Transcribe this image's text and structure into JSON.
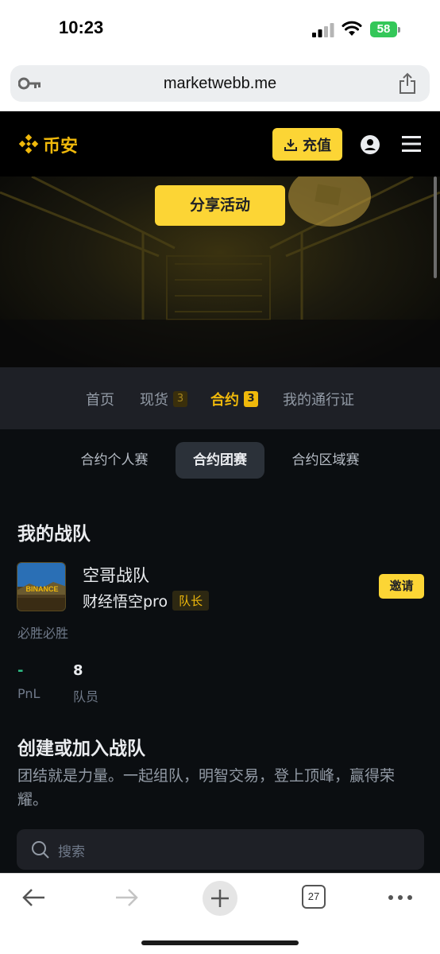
{
  "status_bar": {
    "time": "10:23",
    "battery": "58"
  },
  "browser": {
    "url": "marketwebb.me",
    "tabs_count": "27"
  },
  "header": {
    "logo_text": "币安",
    "deposit_label": "充值",
    "accent": "#f0b90b"
  },
  "hero": {
    "share_label": "分享活动"
  },
  "main_tabs": [
    {
      "label": "首页"
    },
    {
      "label": "现货",
      "badge": "3"
    },
    {
      "label": "合约",
      "badge": "3",
      "active": true
    },
    {
      "label": "我的通行证"
    }
  ],
  "sub_tabs": [
    {
      "label": "合约个人赛"
    },
    {
      "label": "合约团赛",
      "active": true
    },
    {
      "label": "合约区域赛"
    }
  ],
  "my_team": {
    "title": "我的战队",
    "name": "空哥战队",
    "owner": "财经悟空pro",
    "role_badge": "队长",
    "invite_label": "邀请",
    "motto": "必胜必胜",
    "avatar_text": "BINANCE",
    "stats": [
      {
        "value": "-",
        "label": "PnL"
      },
      {
        "value": "8",
        "label": "队员"
      }
    ]
  },
  "create_section": {
    "title": "创建或加入战队",
    "description": "团结就是力量。一起组队，明智交易，登上顶峰，赢得荣耀。"
  },
  "search": {
    "placeholder": "搜索"
  }
}
